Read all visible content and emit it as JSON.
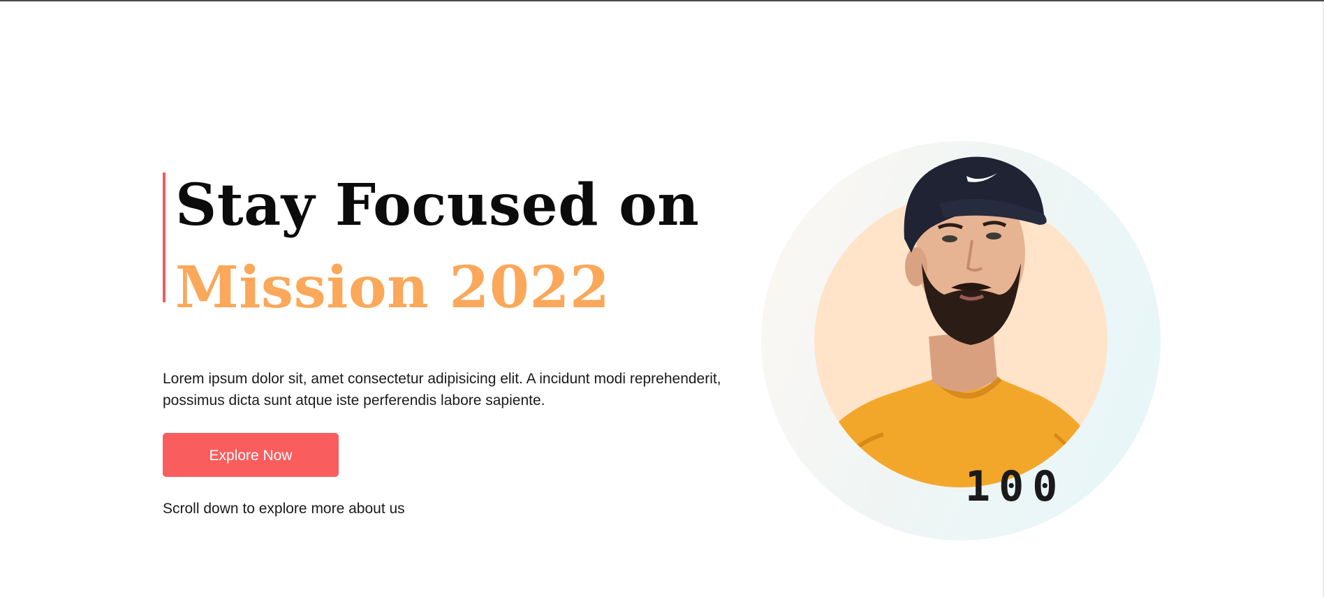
{
  "hero": {
    "title_line1": "Stay Focused on",
    "title_line2": "Mission 2022",
    "description": "Lorem ipsum dolor sit, amet consectetur adipisicing elit. A incidunt modi reprehenderit, possimus dicta sunt atque iste perferendis labore sapiente.",
    "cta_label": "Explore Now",
    "scroll_hint": "Scroll down to explore more about us",
    "shirt_print": "100"
  },
  "colors": {
    "accent": "#f95d5e",
    "title_highlight": "#fba85a",
    "inner_disc": "#ffe4ca",
    "outer_ring_start": "#fdf8f3",
    "outer_ring_end": "#e6f7f9"
  },
  "icons": {
    "cap_logo": "swoosh-icon"
  }
}
